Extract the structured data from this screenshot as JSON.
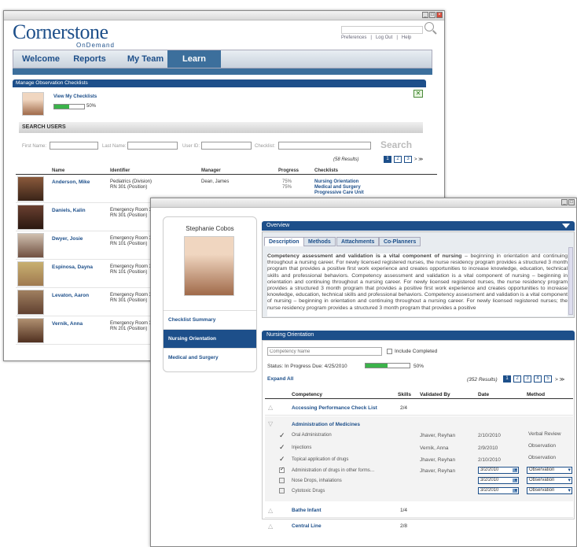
{
  "window1": {
    "brand": {
      "name": "Cornerstone",
      "sub": "OnDemand"
    },
    "toplinks": [
      "Preferences",
      "|",
      "Log Out",
      "|",
      "Help"
    ],
    "nav": [
      "Welcome",
      "Reports",
      "My Team",
      "Learn"
    ],
    "panel_title": "Manage Observation Checklists",
    "view_link": "View My Checklists",
    "my_progress": "50%",
    "my_progress_value": 0.5,
    "search_title": "SEARCH USERS",
    "fields": [
      "First Name:",
      "Last Name:",
      "User ID:",
      "Checklist:"
    ],
    "search_button": "Search",
    "results": "(58 Results)",
    "pages": [
      "1",
      "2",
      "3"
    ],
    "next": "> ≫",
    "columns": [
      "Name",
      "Identifier",
      "Manager",
      "Progress",
      "Checklists"
    ],
    "rows": [
      {
        "name": "Anderson, Mike",
        "id1": "Pediatrics (Division)",
        "id2": "RN 301 (Position)",
        "manager": "Dean, James",
        "progress1": "75%",
        "progress2": "75%",
        "checklists": [
          "Nursing Orientation",
          "Medical and Surgery",
          "Progressive Care Unit"
        ]
      },
      {
        "name": "Daniels, Kalin",
        "id1": "Emergency Room 3",
        "id2": "RN 301 (Position)"
      },
      {
        "name": "Dwyer, Josie",
        "id1": "Emergency Room 3",
        "id2": "RN 101 (Position)"
      },
      {
        "name": "Espinosa, Dayna",
        "id1": "Emergency Room 3",
        "id2": "RN 101 (Position)"
      },
      {
        "name": "Levaton, Aaron",
        "id1": "Emergency Room 3",
        "id2": "RN 301 (Position)"
      },
      {
        "name": "Vernik, Anna",
        "id1": "Emergency Room 3",
        "id2": "RN 201 (Position)"
      }
    ]
  },
  "window2": {
    "user": "Stephanie Cobos",
    "side_items": [
      "Checklist Summary",
      "Nursing Orientation",
      "Medical and Surgery"
    ],
    "overview_title": "Overview",
    "tabs": [
      "Description",
      "Methods",
      "Attachments",
      "Co-Planners"
    ],
    "desc_lead": "Competency assessment and validation is a vital component of nursing",
    "desc_body": " – beginning in orientation and continuing throughout a nursing career. For newly licensed registered nurses, the nurse residency program provides a structured 3 month program that provides a positive first work experience and creates opportunities to increase knowledge, education, technical skills and professional behaviors. Competency assessment and validation is a vital component of nursing – beginning in orientation and continuing throughout a nursing career. For newly licensed registered nurses, the nurse residency program provides a structured 3 month program that provides a positive first work experience and creates opportunities to increase knowledge, education, technical skills and professional behaviors. Competency assessment and validation is a vital component of nursing – beginning in orientation and continuing throughout a nursing career. For newly licensed registered nurses; the nurse residency program provides a structured 3 month program that provides a positive",
    "section_title": "Nursing Orientation",
    "comp_placeholder": "Competency Name",
    "include_completed": "Include Completed",
    "status_label": "Status:",
    "status_value": "In Progress",
    "due_label": "Due:",
    "due_value": "4/25/2010",
    "status_progress": "50%",
    "status_progress_value": 0.5,
    "expand_all": "Expand All",
    "results": "(352 Results)",
    "pages": [
      "1",
      "2",
      "3",
      "4",
      "5"
    ],
    "next": "> ≫",
    "columns": [
      "Competency",
      "Skills",
      "Validated By",
      "Date",
      "Method"
    ],
    "groups": [
      {
        "name": "Accessing Performance Check List",
        "skills": "2/4"
      },
      {
        "name": "Administration of Medicines",
        "skills": ""
      },
      {
        "name": "Bathe Infant",
        "skills": "1/4"
      },
      {
        "name": "Central Line",
        "skills": "2/8"
      }
    ],
    "items": [
      {
        "name": "Oral Administration",
        "by": "Jhaver, Reyhan",
        "date": "2/10/2010",
        "method": "Verbal Review",
        "mark": "check"
      },
      {
        "name": "Injections",
        "by": "Vernik, Anna",
        "date": "2/9/2010",
        "method": "Observation",
        "mark": "check"
      },
      {
        "name": "Topical application of drugs",
        "by": "Jhaver, Reyhan",
        "date": "2/10/2010",
        "method": "Observation",
        "mark": "check"
      },
      {
        "name": "Administration of drugs in other forms…",
        "by": "Jhaver, Reyhan",
        "date": "3/2/2010",
        "method": "Observation",
        "mark": "box-checked"
      },
      {
        "name": "Nose Drops, inhalations",
        "by": "",
        "date": "3/2/2010",
        "method": "Observation",
        "mark": "box"
      },
      {
        "name": "Cytotoxic Drugs",
        "by": "",
        "date": "3/2/2010",
        "method": "Observation",
        "mark": "box"
      }
    ]
  }
}
